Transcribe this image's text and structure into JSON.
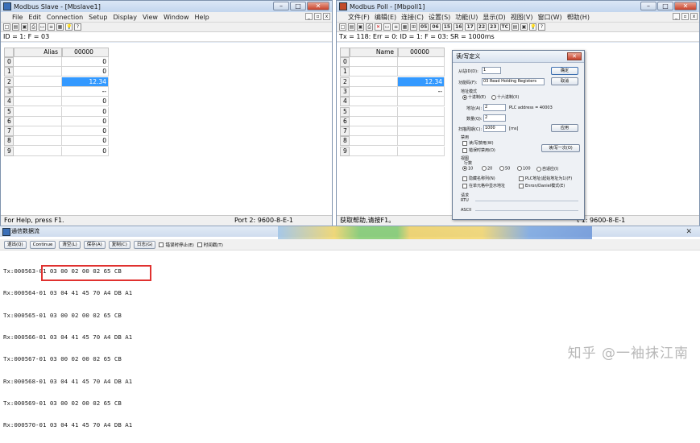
{
  "slave": {
    "title": "Modbus Slave - [Mbslave1]",
    "menu": [
      "File",
      "Edit",
      "Connection",
      "Setup",
      "Display",
      "View",
      "Window",
      "Help"
    ],
    "id_line": "ID = 1: F = 03",
    "col_alias": "Alias",
    "col_addr": "00000",
    "rows": [
      "0",
      "1",
      "2",
      "3",
      "4",
      "5",
      "6",
      "7",
      "8",
      "9"
    ],
    "values": [
      "0",
      "0",
      "12.34",
      "--",
      "0",
      "0",
      "0",
      "0",
      "0",
      "0"
    ],
    "status_left": "For Help, press F1.",
    "status_right": "Port 2: 9600-8-E-1"
  },
  "poll": {
    "title": "Modbus Poll - [Mbpoll1]",
    "menu": [
      "文件(F)",
      "编辑(E)",
      "连接(C)",
      "设置(S)",
      "功能(U)",
      "显示(D)",
      "视图(V)",
      "窗口(W)",
      "帮助(H)"
    ],
    "toolbar_codes": [
      "05",
      "06",
      "15",
      "16",
      "17",
      "22",
      "23",
      "TC"
    ],
    "tx_line": "Tx = 118: Err = 0: ID = 1: F = 03: SR = 1000ms",
    "col_name": "Name",
    "col_addr": "00000",
    "rows": [
      "0",
      "1",
      "2",
      "3",
      "4",
      "5",
      "6",
      "7",
      "8",
      "9"
    ],
    "values": [
      "",
      "",
      "12.34",
      "--",
      "",
      "",
      "",
      "",
      "",
      ""
    ],
    "status_left": "获取帮助,请按F1。",
    "status_right": "t 1: 9600-8-E-1"
  },
  "dialog": {
    "title": "读/写定义",
    "slave_label": "从站ID(D):",
    "slave_value": "1",
    "func_label": "功能码(F):",
    "func_value": "03 Read Holding Registers (4x)",
    "ok": "确定",
    "cancel": "取消",
    "addr_mode": "地址模式",
    "dec": "十进制(E)",
    "hex": "十六进制(X)",
    "addr_label": "地址(A):",
    "addr_value": "2",
    "plc_addr": "PLC address = 40003",
    "qty_label": "数量(Q):",
    "qty_value": "2",
    "scan_label": "扫描周期(C):",
    "scan_value": "1000",
    "scan_unit": "[ms]",
    "apply": "应用",
    "disable": "禁用",
    "rw_disabled": "读/写禁用(W)",
    "err_disabled": "错误时禁用(O)",
    "rw_once": "读/写一次(O)",
    "view": "视图",
    "rows_label": "行数",
    "row_opts": [
      "10",
      "20",
      "50",
      "100",
      "自适应(I)"
    ],
    "hide_alias": "隐藏名称列(N)",
    "show_addr": "在单元格中显示地址",
    "plc_base": "PLC地址(起始地址为1)(F)",
    "enron": "Enron/Daniel模式(E)",
    "req": "请求",
    "rtu": "RTU",
    "ascii": "ASCII"
  },
  "traffic": {
    "title": "通信数据流",
    "buttons": [
      "退出(Q)",
      "Continue",
      "清空(L)",
      "保存(A)",
      "复制(C)",
      "日志(G)"
    ],
    "stop_label": "错误时停止(E)",
    "time_label": "时间戳(T)",
    "lines": [
      "Tx:000563-01 03 00 02 00 02 65 CB",
      "Rx:000564-01 03 04 41 45 70 A4 DB A1",
      "Tx:000565-01 03 00 02 00 02 65 CB",
      "Rx:000566-01 03 04 41 45 70 A4 DB A1",
      "Tx:000567-01 03 00 02 00 02 65 CB",
      "Rx:000568-01 03 04 41 45 70 A4 DB A1",
      "Tx:000569-01 03 00 02 00 02 65 CB",
      "Rx:000570-01 03 04 41 45 70 A4 DB A1"
    ]
  },
  "watermark": "知乎 @一袖抹江南"
}
